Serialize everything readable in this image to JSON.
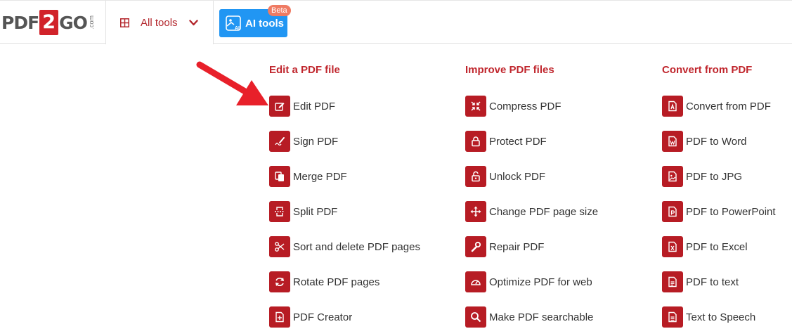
{
  "header": {
    "logo": {
      "left": "PDF",
      "box": "2",
      "right": "GO",
      "suffix": ".com"
    },
    "all_tools_label": "All tools",
    "ai_tools_label": "AI tools",
    "beta_badge": "Beta"
  },
  "columns": [
    {
      "title": "Edit a PDF file",
      "items": [
        {
          "label": "Edit PDF",
          "icon": "edit-icon"
        },
        {
          "label": "Sign PDF",
          "icon": "sign-icon"
        },
        {
          "label": "Merge PDF",
          "icon": "merge-icon"
        },
        {
          "label": "Split PDF",
          "icon": "split-icon"
        },
        {
          "label": "Sort and delete PDF pages",
          "icon": "scissors-icon"
        },
        {
          "label": "Rotate PDF pages",
          "icon": "rotate-icon"
        },
        {
          "label": "PDF Creator",
          "icon": "file-plus-icon"
        }
      ]
    },
    {
      "title": "Improve PDF files",
      "items": [
        {
          "label": "Compress PDF",
          "icon": "compress-icon"
        },
        {
          "label": "Protect PDF",
          "icon": "lock-icon"
        },
        {
          "label": "Unlock PDF",
          "icon": "unlock-icon"
        },
        {
          "label": "Change PDF page size",
          "icon": "move-icon"
        },
        {
          "label": "Repair PDF",
          "icon": "wrench-icon"
        },
        {
          "label": "Optimize PDF for web",
          "icon": "gauge-icon"
        },
        {
          "label": "Make PDF searchable",
          "icon": "search-icon"
        }
      ]
    },
    {
      "title": "Convert from PDF",
      "items": [
        {
          "label": "Convert from PDF",
          "icon": "pdf-file-icon"
        },
        {
          "label": "PDF to Word",
          "icon": "word-file-icon"
        },
        {
          "label": "PDF to JPG",
          "icon": "image-file-icon"
        },
        {
          "label": "PDF to PowerPoint",
          "icon": "powerpoint-file-icon"
        },
        {
          "label": "PDF to Excel",
          "icon": "excel-file-icon"
        },
        {
          "label": "PDF to text",
          "icon": "text-file-icon"
        },
        {
          "label": "Text to Speech",
          "icon": "speech-file-icon"
        }
      ]
    }
  ],
  "colors": {
    "brand_red": "#d1232a",
    "icon_red": "#b71c24",
    "heading_red": "#c0262d",
    "ai_blue": "#2196f3",
    "beta_orange": "#ef7b63",
    "arrow_red": "#e8202a"
  }
}
